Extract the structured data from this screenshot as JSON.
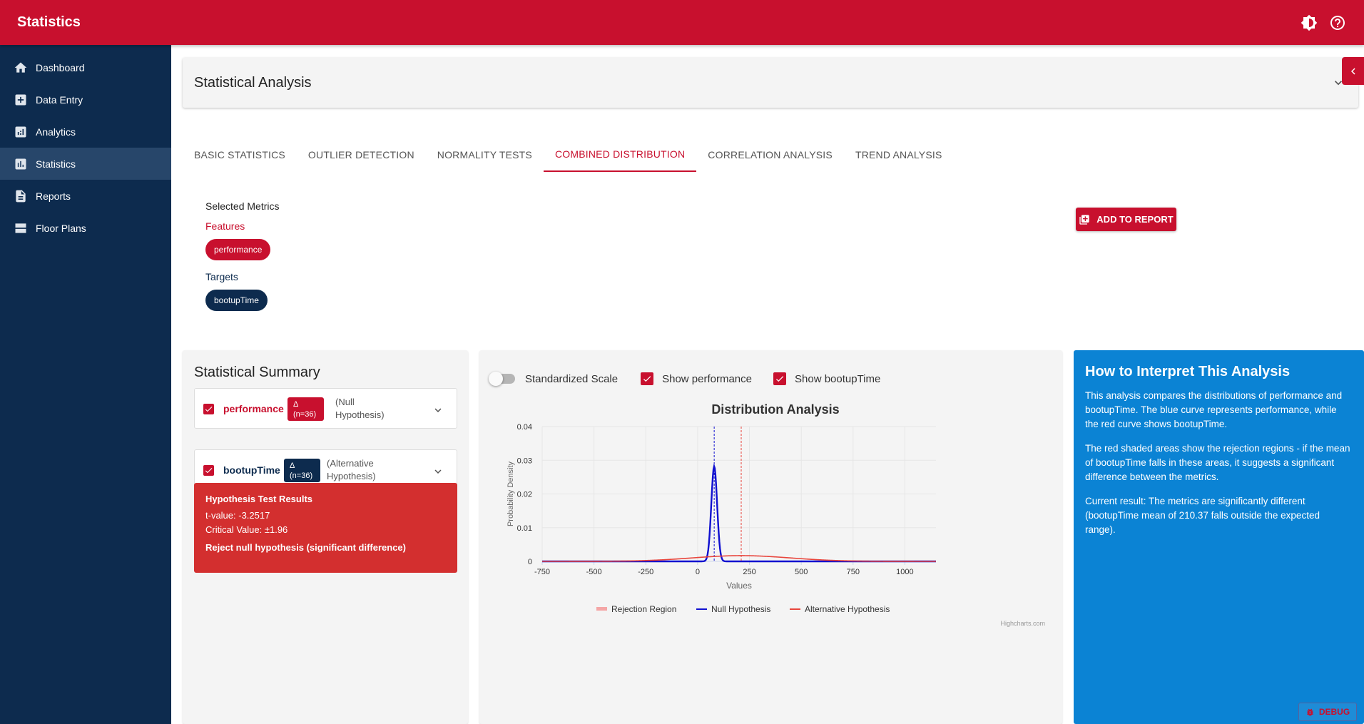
{
  "app": {
    "title": "Statistics"
  },
  "sidebar": {
    "items": [
      {
        "label": "Dashboard",
        "icon": "home-icon"
      },
      {
        "label": "Data Entry",
        "icon": "plus-box-icon"
      },
      {
        "label": "Analytics",
        "icon": "analytics-icon"
      },
      {
        "label": "Statistics",
        "icon": "bar-chart-icon",
        "active": true
      },
      {
        "label": "Reports",
        "icon": "document-icon"
      },
      {
        "label": "Floor Plans",
        "icon": "floor-plan-icon"
      }
    ]
  },
  "header": {
    "title": "Statistical Analysis"
  },
  "tabs": [
    {
      "label": "BASIC STATISTICS"
    },
    {
      "label": "OUTLIER DETECTION"
    },
    {
      "label": "NORMALITY TESTS"
    },
    {
      "label": "COMBINED DISTRIBUTION",
      "active": true
    },
    {
      "label": "CORRELATION ANALYSIS"
    },
    {
      "label": "TREND ANALYSIS"
    }
  ],
  "selected": {
    "title": "Selected Metrics",
    "features_label": "Features",
    "feature_chip": "performance",
    "targets_label": "Targets",
    "target_chip": "bootupTime"
  },
  "add_report": "ADD TO REPORT",
  "summary": {
    "title": "Statistical Summary",
    "rows": [
      {
        "name": "performance",
        "badge_line1": "Δ",
        "badge_line2": "(n=36)",
        "desc_line1": "(Null",
        "desc_line2": "Hypothesis)"
      },
      {
        "name": "bootupTime",
        "badge_line1": "Δ",
        "badge_line2": "(n=36)",
        "desc_line1": "(Alternative",
        "desc_line2": "Hypothesis)"
      }
    ],
    "hypothesis": {
      "title": "Hypothesis Test Results",
      "t_value": "t-value: -3.2517",
      "critical": "Critical Value: ±1.96",
      "result": "Reject null hypothesis (significant difference)"
    }
  },
  "controls": {
    "standardized": "Standardized Scale",
    "show_a": "Show performance",
    "show_b": "Show bootupTime"
  },
  "chart_data": {
    "type": "line",
    "title": "Distribution Analysis",
    "xlabel": "Values",
    "ylabel": "Probability Density",
    "xlim": [
      -750,
      1150
    ],
    "ylim": [
      0,
      0.04
    ],
    "x_ticks": [
      -750,
      -500,
      -250,
      0,
      250,
      500,
      750,
      1000
    ],
    "y_ticks": [
      0,
      0.01,
      0.02,
      0.03,
      0.04
    ],
    "y_tick_labels": [
      "0",
      "0.01",
      "0.02",
      "0.03",
      "0.04"
    ],
    "grid": true,
    "legend_position": "bottom",
    "series": [
      {
        "name": "Rejection Region",
        "color": "#f4a6a6",
        "kind": "area"
      },
      {
        "name": "Null Hypothesis",
        "color": "#1010d0",
        "kind": "normal",
        "mean": 80,
        "sd": 14,
        "peak": 0.0282,
        "mean_line": 80
      },
      {
        "name": "Alternative Hypothesis",
        "color": "#e8453c",
        "kind": "normal",
        "mean": 210.37,
        "sd": 235,
        "peak": 0.0017,
        "mean_line": 210.37
      }
    ],
    "credit": "Highcharts.com"
  },
  "interpret": {
    "title": "How to Interpret This Analysis",
    "p1": "This analysis compares the distributions of performance and bootupTime. The blue curve represents performance, while the red curve shows bootupTime.",
    "p2": "The red shaded areas show the rejection regions - if the mean of bootupTime falls in these areas, it suggests a significant difference between the metrics.",
    "p3": "Current result: The metrics are significantly different (bootupTime mean of 210.37 falls outside the expected range)."
  },
  "debug": "DEBUG",
  "colors": {
    "brand": "#c8102e",
    "sidebar": "#0d2b4e",
    "info": "#0b83d4",
    "danger": "#d32f2f"
  }
}
